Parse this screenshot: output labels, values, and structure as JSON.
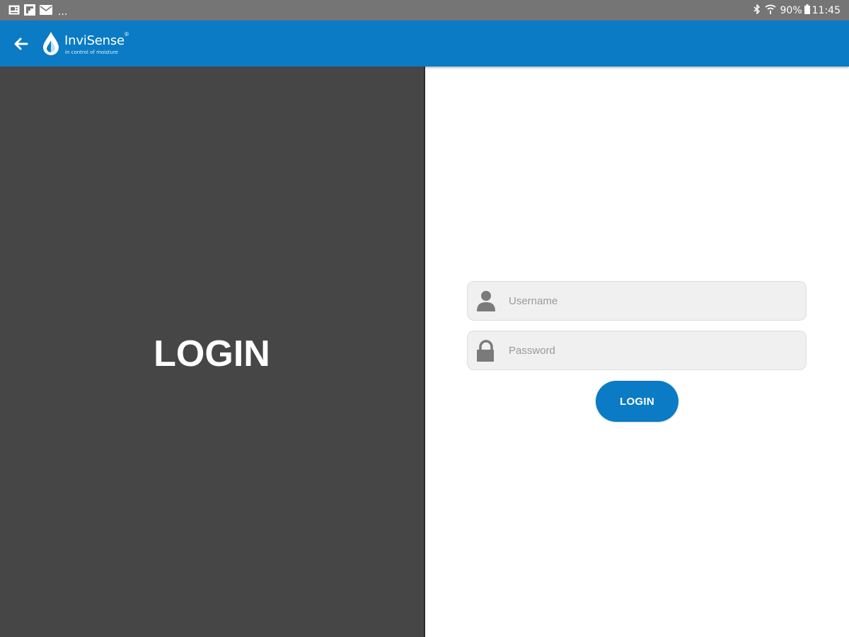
{
  "status_bar": {
    "notification_icons": [
      "photo-notification-icon",
      "flipboard-notification-icon",
      "mail-notification-icon"
    ],
    "overflow": "...",
    "bluetooth_icon": "bluetooth-icon",
    "wifi_icon": "wifi-icon",
    "battery_percent": "90%",
    "battery_icon": "battery-icon",
    "time": "11:45"
  },
  "app_bar": {
    "back_icon": "back-arrow-icon",
    "brand": "InviSense",
    "brand_mark": "®",
    "tagline": "in control of moisture",
    "color": "#0a7bc4"
  },
  "left_panel": {
    "title": "LOGIN",
    "background": "#464646"
  },
  "login_form": {
    "username": {
      "placeholder": "Username",
      "value": "",
      "icon": "user-icon"
    },
    "password": {
      "placeholder": "Password",
      "value": "",
      "icon": "lock-icon"
    },
    "submit_label": "LOGIN"
  }
}
